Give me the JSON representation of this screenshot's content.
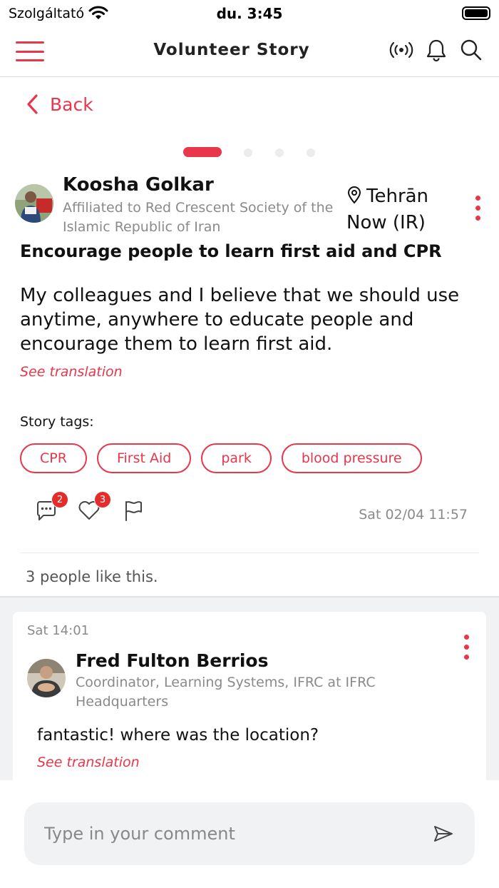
{
  "status_bar": {
    "carrier": "Szolgáltató",
    "time": "du. 3:45"
  },
  "header": {
    "title": "Volunteer Story"
  },
  "nav": {
    "back_label": "Back"
  },
  "story": {
    "author": {
      "name": "Koosha Golkar",
      "affiliation": "Affiliated to Red Crescent Society of the Islamic Republic of Iran"
    },
    "location_line1": "Tehrān",
    "location_line2": "Now (IR)",
    "title": "Encourage people to learn first aid and CPR",
    "body": "My colleagues and I believe that we should use anytime, anywhere to educate people and encourage them to learn first aid.",
    "see_translation": "See translation",
    "tags_label": "Story tags:",
    "tags": [
      "CPR",
      "First Aid",
      "park",
      "blood pressure"
    ],
    "comment_count": "2",
    "like_count": "3",
    "date": "Sat 02/04 11:57",
    "likes_text": "3 people like this."
  },
  "comments": [
    {
      "date": "Sat 14:01",
      "author": "Fred Fulton Berrios",
      "role": "Coordinator, Learning Systems, IFRC at IFRC Headquarters",
      "text": "fantastic! where was the location?",
      "see_translation": "See translation"
    }
  ],
  "composer": {
    "placeholder": "Type in your comment"
  },
  "icons": {
    "menu": "hamburger-menu-icon",
    "broadcast": "broadcast-icon",
    "notifications": "bell-icon",
    "search": "search-icon",
    "back": "chevron-left-icon",
    "location": "map-pin-icon",
    "comment": "comment-icon",
    "like": "heart-icon",
    "report": "flag-icon",
    "send": "send-icon"
  },
  "colors": {
    "accent": "#e8364a",
    "badge": "#e62b2b",
    "muted": "#8a8a8a"
  }
}
